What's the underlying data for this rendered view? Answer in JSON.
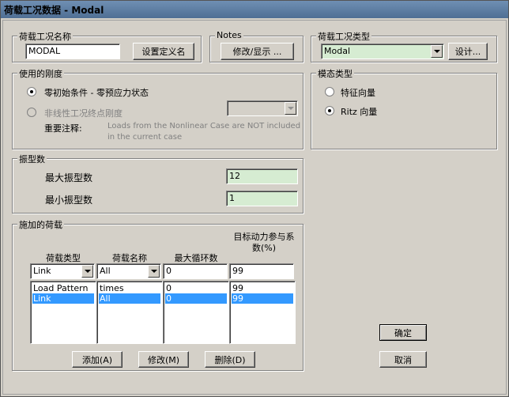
{
  "window": {
    "title": "荷载工况数据 - Modal"
  },
  "case_name": {
    "title": "荷载工况名称",
    "value": "MODAL",
    "button": "设置定义名"
  },
  "notes": {
    "title": "Notes",
    "button": "修改/显示 ..."
  },
  "case_type": {
    "title": "荷载工况类型",
    "selected": "Modal",
    "button": "设计..."
  },
  "stiffness": {
    "title": "使用的刚度",
    "option1": "零初始条件 - 零预应力状态",
    "option2": "非线性工况终点刚度",
    "note_label": "重要注释:",
    "note_text1": "Loads from the Nonlinear Case are NOT included",
    "note_text2": "in the current case"
  },
  "modal_type": {
    "title": "模态类型",
    "option1": "特征向量",
    "option2": "Ritz 向量"
  },
  "num_modes": {
    "title": "振型数",
    "max_label": "最大振型数",
    "max_value": "12",
    "min_label": "最小振型数",
    "min_value": "1"
  },
  "loads": {
    "title": "施加的荷载",
    "headers": {
      "type": "荷载类型",
      "name": "荷载名称",
      "cycles": "最大循环数",
      "ratio_line1": "目标动力参与系",
      "ratio_line2": "数(%)"
    },
    "edit": {
      "type": "Link",
      "name": "All",
      "cycles": "0",
      "ratio": "99"
    },
    "rows": [
      {
        "type": "Load Pattern",
        "name": "times",
        "cycles": "0",
        "ratio": "99"
      },
      {
        "type": "Link",
        "name": "All",
        "cycles": "0",
        "ratio": "99"
      }
    ],
    "add": "添加(A)",
    "modify": "修改(M)",
    "delete": "删除(D)"
  },
  "buttons": {
    "ok": "确定",
    "cancel": "取消"
  }
}
